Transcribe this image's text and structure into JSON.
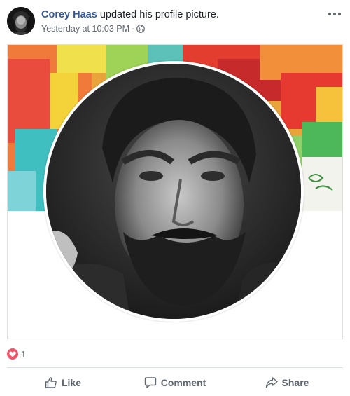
{
  "post": {
    "author": "Corey Haas",
    "action_text": " updated his profile picture.",
    "timestamp": "Yesterday at 10:03 PM",
    "separator": "·",
    "audience_icon": "globe-icon",
    "menu_icon": "more-options-icon"
  },
  "reactions": {
    "icon": "heart-icon",
    "count": "1"
  },
  "actions": [
    {
      "label": "Like",
      "icon": "thumbs-up-icon"
    },
    {
      "label": "Comment",
      "icon": "comment-icon"
    },
    {
      "label": "Share",
      "icon": "share-icon"
    }
  ],
  "colors": {
    "author_link": "#365899",
    "meta_text": "#616770",
    "action_text": "#606770",
    "heart": "#f25268",
    "divider": "#dadde1"
  }
}
